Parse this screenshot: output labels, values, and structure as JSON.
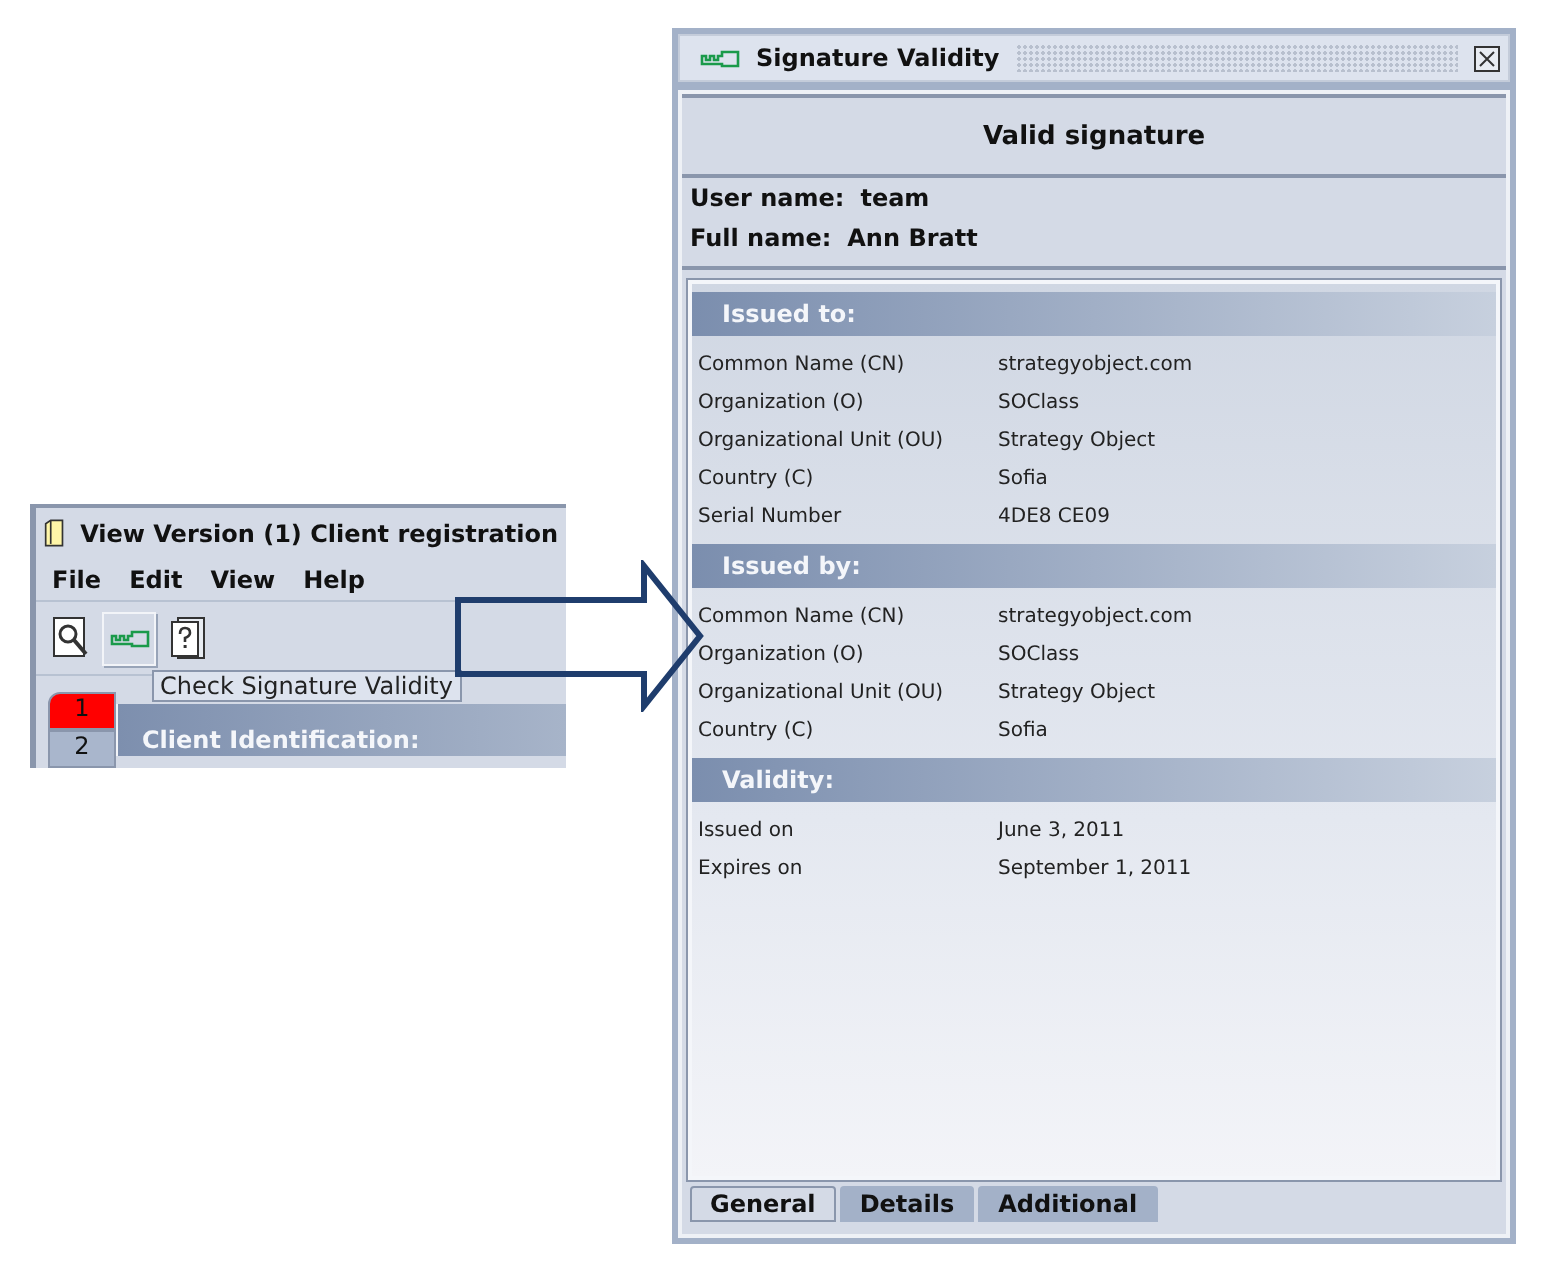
{
  "app_window": {
    "title": "View Version (1)  Client registration",
    "menu": [
      "File",
      "Edit",
      "View",
      "Help"
    ],
    "toolbar": [
      {
        "kind": "preview",
        "hovered": false
      },
      {
        "kind": "signature",
        "hovered": true
      },
      {
        "kind": "help",
        "hovered": false
      }
    ],
    "tooltip": "Check Signature Validity",
    "page_tabs": [
      {
        "label": "1",
        "selected": true
      },
      {
        "label": "2",
        "selected": false
      }
    ],
    "section_header": "Client Identification:"
  },
  "dialog": {
    "title": "Signature Validity",
    "status": "Valid signature",
    "user": [
      {
        "label": "User name:",
        "value": "team"
      },
      {
        "label": "Full name:",
        "value": "Ann Bratt"
      }
    ],
    "sections": [
      {
        "title": "Issued to:",
        "rows": [
          [
            "Common Name (CN)",
            "strategyobject.com"
          ],
          [
            "Organization (O)",
            "SOClass"
          ],
          [
            "Organizational Unit (OU)",
            "Strategy Object"
          ],
          [
            "Country (C)",
            "Sofia"
          ],
          [
            "Serial Number",
            "4DE8 CE09"
          ]
        ]
      },
      {
        "title": "Issued by:",
        "rows": [
          [
            "Common Name (CN)",
            "strategyobject.com"
          ],
          [
            "Organization (O)",
            "SOClass"
          ],
          [
            "Organizational Unit (OU)",
            "Strategy Object"
          ],
          [
            "Country (C)",
            "Sofia"
          ]
        ]
      },
      {
        "title": "Validity:",
        "rows": [
          [
            "Issued on",
            "June 3, 2011"
          ],
          [
            "Expires on",
            "September 1, 2011"
          ]
        ]
      }
    ],
    "tabs": [
      {
        "label": "General",
        "selected": true
      },
      {
        "label": "Details",
        "selected": false
      },
      {
        "label": "Additional",
        "selected": false
      }
    ]
  }
}
